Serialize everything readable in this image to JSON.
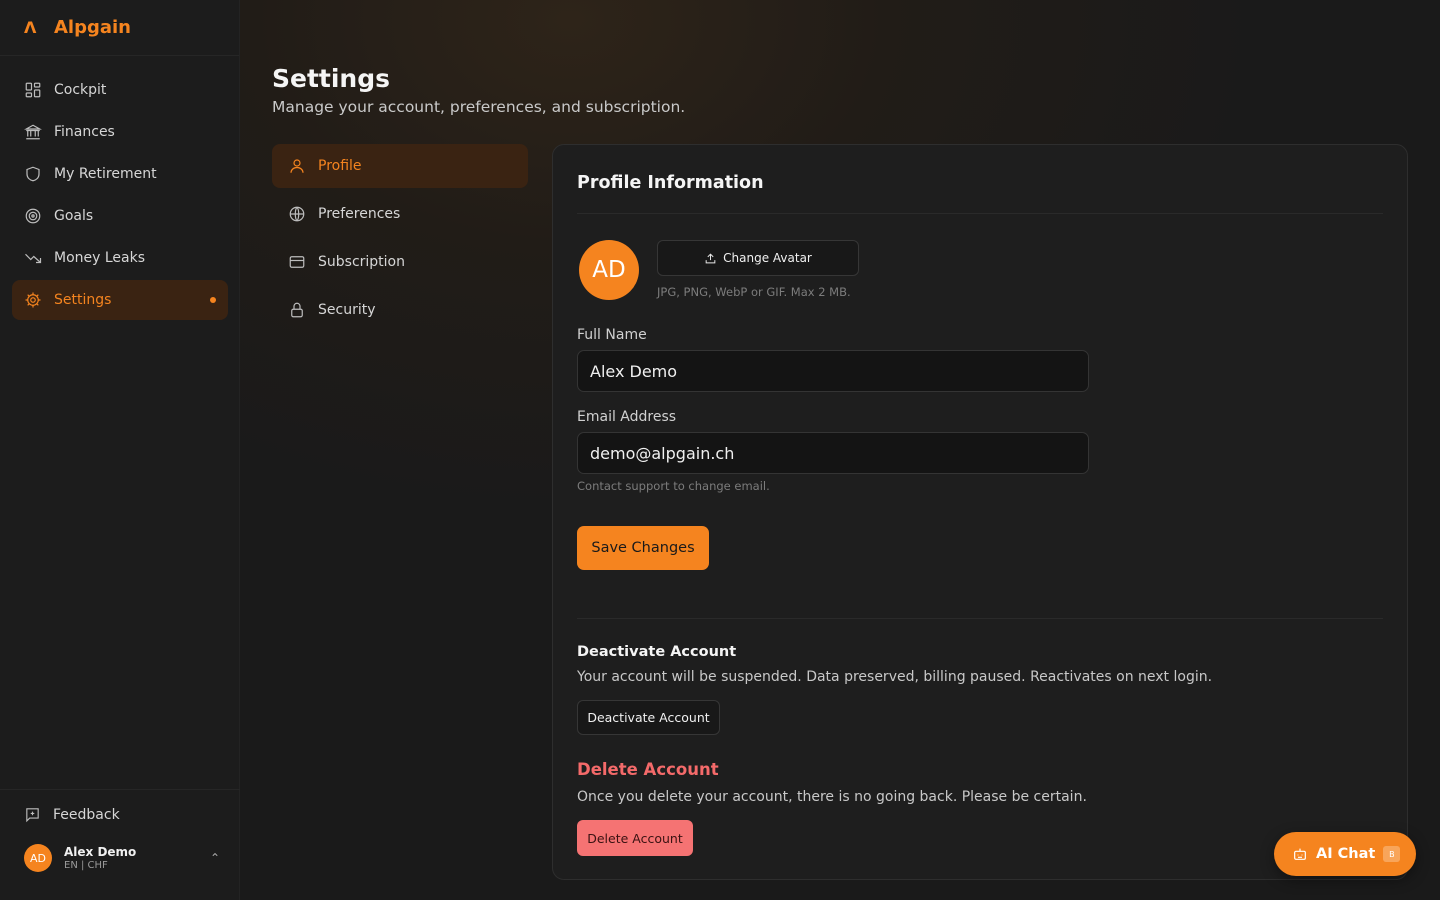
{
  "brand": {
    "name": "Alpgain",
    "logo_glyph": "Λ",
    "accent": "#f5841f"
  },
  "sidebar": {
    "items": [
      {
        "label": "Cockpit",
        "icon": "grid-icon"
      },
      {
        "label": "Finances",
        "icon": "bank-icon"
      },
      {
        "label": "My Retirement",
        "icon": "shield-icon"
      },
      {
        "label": "Goals",
        "icon": "target-icon"
      },
      {
        "label": "Money Leaks",
        "icon": "trending-down-icon"
      },
      {
        "label": "Settings",
        "icon": "gear-icon",
        "active": true
      }
    ],
    "feedback_label": "Feedback",
    "user": {
      "initials": "AD",
      "name": "Alex Demo",
      "meta": "EN | CHF"
    }
  },
  "page": {
    "title": "Settings",
    "subtitle": "Manage your account, preferences, and subscription."
  },
  "subnav": {
    "items": [
      {
        "label": "Profile",
        "icon": "user-icon",
        "active": true
      },
      {
        "label": "Preferences",
        "icon": "globe-icon"
      },
      {
        "label": "Subscription",
        "icon": "credit-card-icon"
      },
      {
        "label": "Security",
        "icon": "lock-icon"
      }
    ]
  },
  "profile": {
    "title": "Profile Information",
    "avatar_initials": "AD",
    "change_avatar_label": "Change Avatar",
    "avatar_hint": "JPG, PNG, WebP or GIF. Max 2 MB.",
    "full_name_label": "Full Name",
    "full_name_value": "Alex Demo",
    "email_label": "Email Address",
    "email_value": "demo@alpgain.ch",
    "email_hint": "Contact support to change email.",
    "save_label": "Save Changes"
  },
  "deactivate": {
    "title": "Deactivate Account",
    "text": "Your account will be suspended. Data preserved, billing paused. Reactivates on next login.",
    "button_label": "Deactivate Account"
  },
  "delete": {
    "title": "Delete Account",
    "text": "Once you delete your account, there is no going back. Please be certain.",
    "button_label": "Delete Account",
    "color": "#f46a6a"
  },
  "ai_chat": {
    "label": "AI Chat",
    "badge": "B"
  }
}
